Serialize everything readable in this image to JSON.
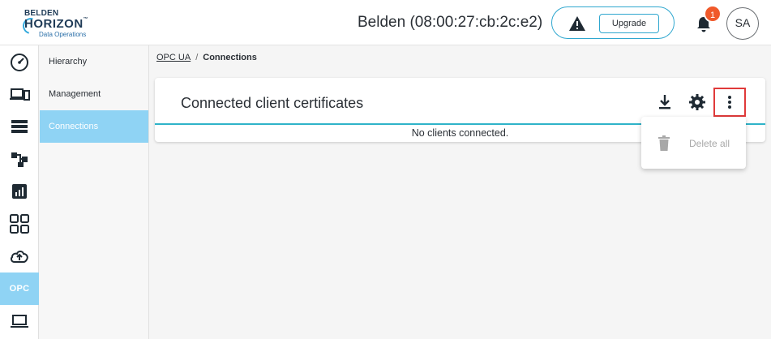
{
  "header": {
    "logo": {
      "brand": "BELDEN",
      "product": "HORIZON",
      "trademark": "™",
      "subtitle": "Data Operations"
    },
    "device_title": "Belden (08:00:27:cb:2c:e2)",
    "upgrade_label": "Upgrade",
    "notification_count": "1",
    "avatar_initials": "SA"
  },
  "rail": {
    "items": [
      {
        "icon": "dashboard-gauge-icon"
      },
      {
        "icon": "devices-icon"
      },
      {
        "icon": "server-list-icon"
      },
      {
        "icon": "hierarchy-tree-icon"
      },
      {
        "icon": "analytics-chart-icon"
      },
      {
        "icon": "apps-grid-icon"
      },
      {
        "icon": "cloud-upload-icon"
      },
      {
        "label": "OPC",
        "active": true
      },
      {
        "icon": "laptop-icon"
      }
    ]
  },
  "submenu": {
    "items": [
      {
        "label": "Hierarchy"
      },
      {
        "label": "Management"
      },
      {
        "label": "Connections",
        "active": true
      }
    ]
  },
  "breadcrumb": {
    "parent": "OPC UA",
    "separator": "/",
    "current": "Connections"
  },
  "card": {
    "title": "Connected client certificates",
    "empty_message": "No clients connected.",
    "actions": [
      "download-icon",
      "gear-icon",
      "more-vertical-icon"
    ]
  },
  "dropdown": {
    "items": [
      {
        "label": "Delete all",
        "icon": "trash-icon",
        "disabled": true
      }
    ]
  },
  "colors": {
    "accent": "#2fa7cf",
    "active_bg": "#8fd3f4",
    "badge": "#f0592a",
    "highlight_border": "#e03a3a",
    "divider": "#2fb3c9"
  }
}
